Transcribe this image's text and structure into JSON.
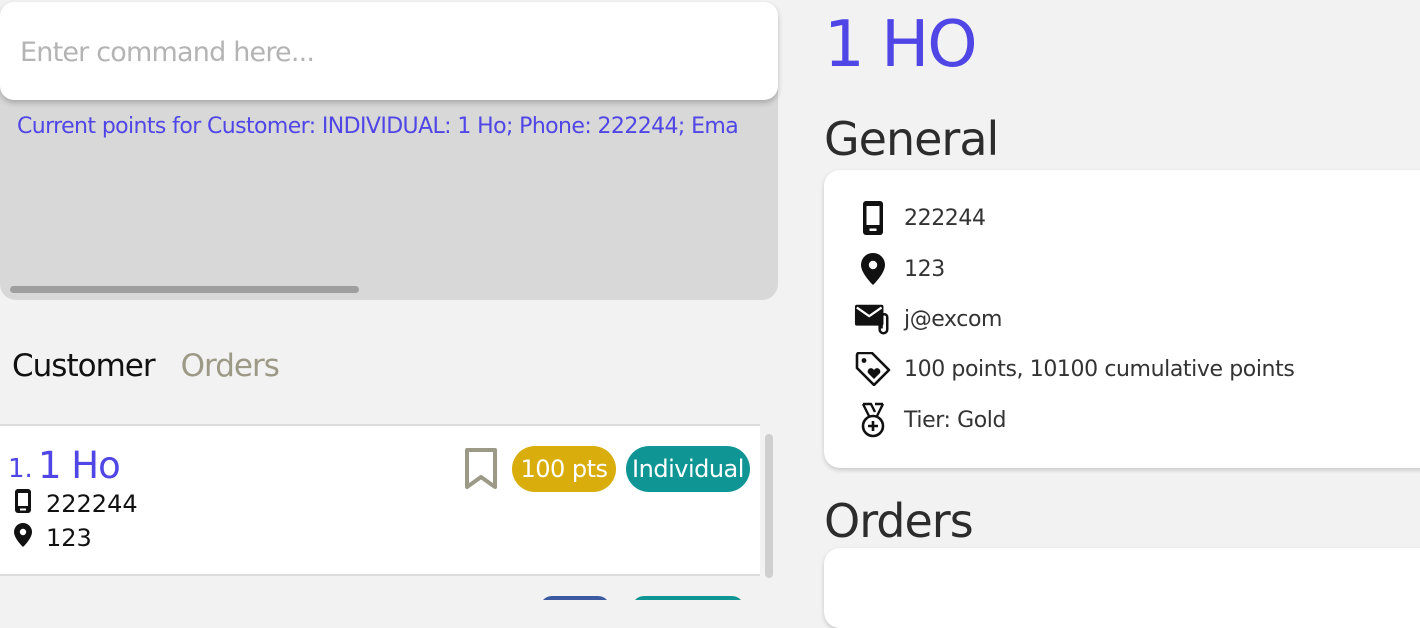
{
  "command": {
    "placeholder": "Enter command here...",
    "value": ""
  },
  "result": {
    "text": "Current points for Customer: INDIVIDUAL: 1 Ho; Phone: 222244; Ema"
  },
  "tabs": [
    {
      "label": "Customer",
      "active": true
    },
    {
      "label": "Orders",
      "active": false
    }
  ],
  "customers": [
    {
      "index": "1.",
      "name": "1 Ho",
      "phone": "222244",
      "address": "123",
      "points_badge": "100 pts",
      "type_badge": "Individual",
      "bookmarked": false
    }
  ],
  "detail": {
    "name": "1 HO",
    "general_title": "General",
    "phone": "222244",
    "address": "123",
    "email": "j@excom",
    "points": "100 points, 10100 cumulative points",
    "tier": "Tier: Gold",
    "orders_title": "Orders"
  },
  "colors": {
    "accent": "#5046e6",
    "points_badge": "#d9ad0b",
    "type_badge": "#0f9694"
  },
  "icons": [
    "phone-icon",
    "location-icon",
    "email-icon",
    "tag-heart-icon",
    "medal-icon",
    "bookmark-icon"
  ]
}
